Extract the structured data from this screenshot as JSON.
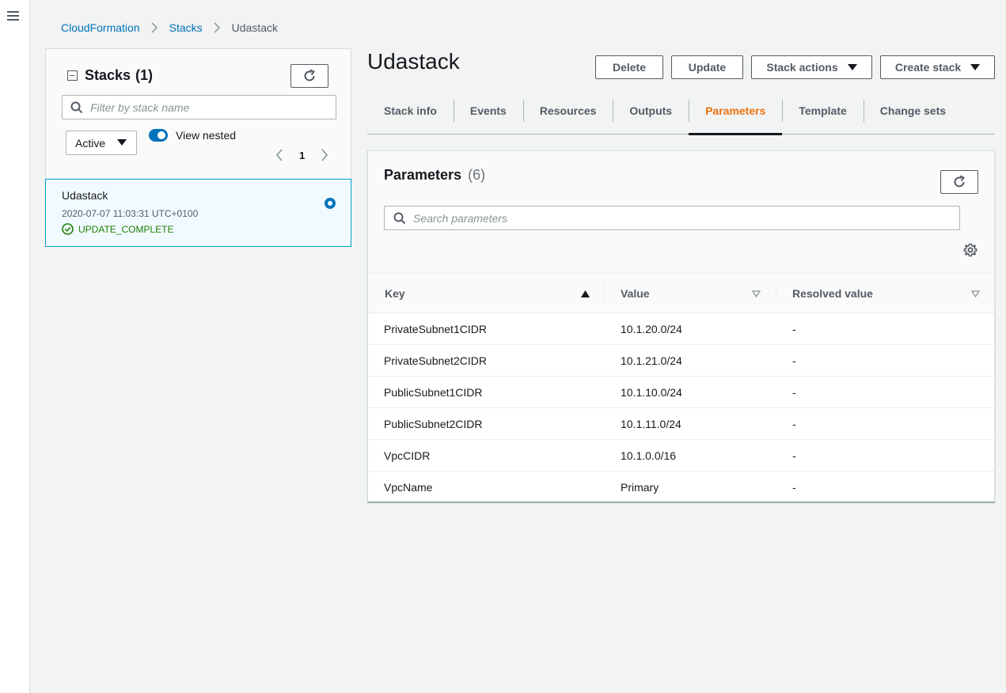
{
  "breadcrumb": {
    "items": [
      "CloudFormation",
      "Stacks"
    ],
    "current": "Udastack"
  },
  "stacks_panel": {
    "title": "Stacks",
    "count": "(1)",
    "filter_placeholder": "Filter by stack name",
    "status_filter": "Active",
    "toggle_label": "View nested",
    "page": "1",
    "stacks": [
      {
        "name": "Udastack",
        "date": "2020-07-07 11:03:31 UTC+0100",
        "status": "UPDATE_COMPLETE",
        "selected": true
      }
    ]
  },
  "main": {
    "title": "Udastack",
    "buttons": {
      "delete": "Delete",
      "update": "Update",
      "stack_actions": "Stack actions",
      "create_stack": "Create stack"
    },
    "tabs": [
      "Stack info",
      "Events",
      "Resources",
      "Outputs",
      "Parameters",
      "Template",
      "Change sets"
    ],
    "active_tab": "Parameters"
  },
  "parameters": {
    "title": "Parameters",
    "count": "(6)",
    "search_placeholder": "Search parameters",
    "columns": {
      "key": "Key",
      "value": "Value",
      "resolved": "Resolved value"
    },
    "rows": [
      {
        "key": "PrivateSubnet1CIDR",
        "value": "10.1.20.0/24",
        "resolved": "-"
      },
      {
        "key": "PrivateSubnet2CIDR",
        "value": "10.1.21.0/24",
        "resolved": "-"
      },
      {
        "key": "PublicSubnet1CIDR",
        "value": "10.1.10.0/24",
        "resolved": "-"
      },
      {
        "key": "PublicSubnet2CIDR",
        "value": "10.1.11.0/24",
        "resolved": "-"
      },
      {
        "key": "VpcCIDR",
        "value": "10.1.0.0/16",
        "resolved": "-"
      },
      {
        "key": "VpcName",
        "value": "Primary",
        "resolved": "-"
      }
    ]
  },
  "colors": {
    "link": "#0073bb",
    "active_tab": "#ec7211",
    "success": "#1d8102",
    "selected_border": "#00a1c9"
  }
}
